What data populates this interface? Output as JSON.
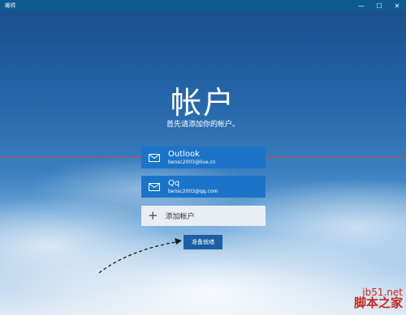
{
  "window": {
    "title": "邮件",
    "controls": {
      "minimize": "—",
      "maximize": "☐",
      "close": "✕"
    }
  },
  "header": {
    "title": "帐户",
    "subtitle": "首先请添加你的帐户。"
  },
  "accounts": [
    {
      "name": "Outlook",
      "email": "bensc2003@live.cn",
      "icon": "mail-icon"
    },
    {
      "name": "Qq",
      "email": "bensc2003@qq.com",
      "icon": "mail-icon"
    }
  ],
  "add_account": {
    "icon": "plus-icon",
    "label": "添加帐户"
  },
  "ready_button": {
    "label": "准备就绪"
  },
  "watermark": {
    "line1": "jb51.net",
    "line2": "脚本之家"
  },
  "colors": {
    "titlebar": "#0f5a93",
    "account_tile": "#1b74c8",
    "ready_button": "#1a5fa3",
    "annotation_line": "#e0433a"
  }
}
